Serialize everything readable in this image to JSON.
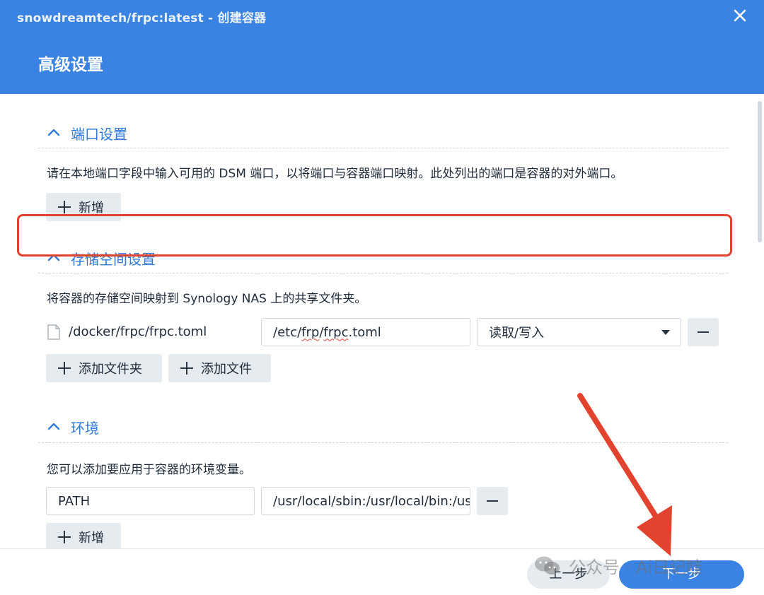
{
  "window": {
    "title": "snowdreamtech/frpc:latest - 创建容器",
    "page_title": "高级设置",
    "close_icon": "close-icon"
  },
  "ports": {
    "title": "端口设置",
    "description": "请在本地端口字段中输入可用的 DSM 端口，以将端口与容器端口映射。此处列出的端口是容器的对外端口。",
    "add_label": "新增"
  },
  "storage": {
    "title": "存储空间设置",
    "description": "将容器的存储空间映射到 Synology NAS 上的共享文件夹。",
    "mount": {
      "host_path": "/docker/frpc/frpc.toml",
      "container_path_prefix": "/etc/",
      "container_path_frp": "frp",
      "container_path_slash": "/",
      "container_path_file": "frpc",
      "container_path_ext": ".toml",
      "permission": "读取/写入"
    },
    "add_folder_label": "添加文件夹",
    "add_file_label": "添加文件"
  },
  "environment": {
    "title": "环境",
    "description": "您可以添加要应用于容器的环境变量。",
    "variables": [
      {
        "name": "PATH",
        "value": "/usr/local/sbin:/usr/local/bin:/usr/sbin:/usr/bin:/sbin:/bin"
      }
    ],
    "add_label": "新增"
  },
  "footer": {
    "prev_label": "上一步",
    "next_label": "下一步"
  },
  "watermark": {
    "text": "公众号 · Ai日记哇"
  },
  "colors": {
    "header_blue": "#3a83e3",
    "section_title_blue": "#2f7ad8",
    "highlight_red": "#e2432f",
    "arrow_red": "#e2432f",
    "button_gray": "#e6ebf0"
  }
}
